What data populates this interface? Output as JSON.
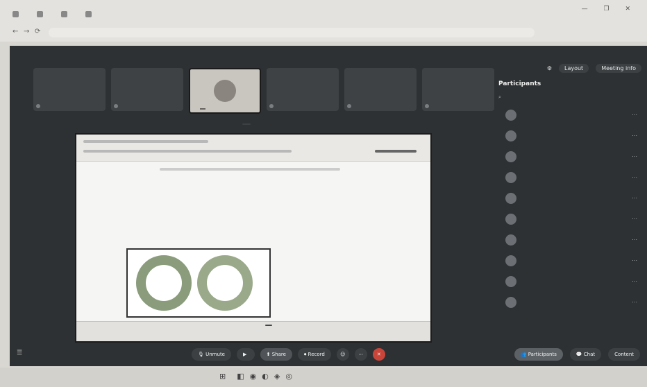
{
  "browser": {
    "tabs": [
      "",
      "",
      "",
      ""
    ],
    "url": "",
    "nav": [
      "←",
      "→",
      "⟳"
    ],
    "window_controls": "— ❐ ✕"
  },
  "meeting": {
    "title": "",
    "top_actions": {
      "pill1": "Layout",
      "pill2": "Meeting info"
    },
    "tiles": [
      {
        "name": "",
        "sub": "",
        "type": "avatar"
      },
      {
        "name": "",
        "sub": "",
        "type": "avatar"
      },
      {
        "name": "",
        "sub": "",
        "type": "video"
      },
      {
        "name": "",
        "sub": "",
        "type": "avatar"
      },
      {
        "name": "",
        "sub": "",
        "type": "avatar"
      },
      {
        "name": "",
        "sub": "",
        "type": "avatar"
      }
    ],
    "share_label": "",
    "zoom": "",
    "shared_screen": {
      "heading": "",
      "subheading": "",
      "paragraph": "",
      "diagram_left": "",
      "diagram_right": "",
      "tooltip": ""
    },
    "participants": {
      "title": "Participants",
      "search_placeholder": "",
      "items": [
        {
          "name": "",
          "status": ""
        },
        {
          "name": "",
          "status": ""
        },
        {
          "name": "",
          "status": ""
        },
        {
          "name": "",
          "status": ""
        },
        {
          "name": "",
          "status": ""
        },
        {
          "name": "",
          "status": ""
        },
        {
          "name": "",
          "status": ""
        },
        {
          "name": "",
          "status": ""
        },
        {
          "name": "",
          "status": ""
        },
        {
          "name": "",
          "status": ""
        }
      ],
      "more_label": ""
    },
    "bottom_bar": {
      "unmute": "Unmute",
      "video": "",
      "share": "Share",
      "record": "Record",
      "participants": "Participants",
      "chat": "Chat",
      "content": "Content"
    }
  },
  "taskbar": {
    "left": "",
    "search": "",
    "right": ""
  }
}
